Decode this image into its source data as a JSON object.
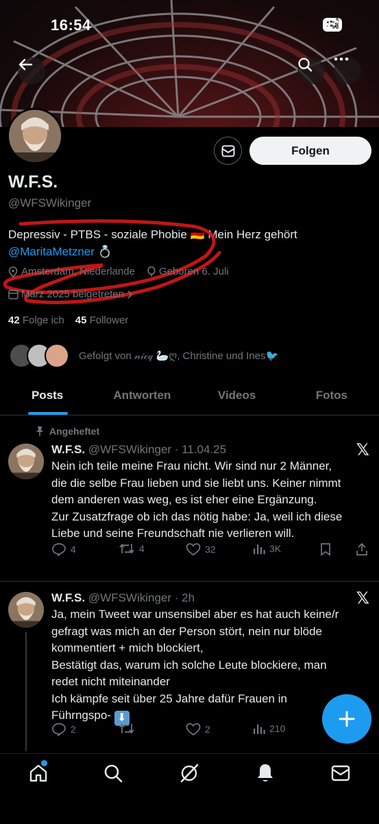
{
  "status_bar": {
    "time": "16:54",
    "battery": "87"
  },
  "profile": {
    "follow_label": "Folgen",
    "name": "W.F.S.",
    "handle": "@WFSWikinger",
    "bio_text": "Depressiv - PTBS - soziale Phobie 🇩🇪 Mein Herz gehört",
    "bio_mention": "@MaritaMetzner",
    "bio_suffix": "💍",
    "location": "Amsterdam, Niederlande",
    "birthday": "Geboren 6. Juli",
    "joined": "März 2025 beigetreten",
    "following_count": "42",
    "following_label": "Folge ich",
    "followers_count": "45",
    "followers_label": "Follower",
    "followed_by": "Gefolgt von 𝓃𝒾𝒸𝓆 🦢ღ, Christine und Ines🐦"
  },
  "tabs": [
    "Posts",
    "Antworten",
    "Videos",
    "Fotos"
  ],
  "pinned_label": "Angeheftet",
  "tweets": [
    {
      "name": "W.F.S.",
      "meta": "@WFSWikinger · 11.04.25",
      "x_label": "𝕏",
      "lines": [
        "Nein ich teile meine Frau nicht. Wir sind nur 2 Männer,",
        "die die selbe Frau lieben und sie liebt uns. Keiner nimmt",
        "dem anderen was weg, es ist eher eine Ergänzung.",
        "Zur Zusatzfrage ob ich das nötig habe:  Ja, weil ich diese",
        "Liebe und seine Freundschaft nie verlieren will."
      ],
      "replies": "4",
      "retweets": "4",
      "likes": "32",
      "views": "3K"
    },
    {
      "name": "W.F.S.",
      "meta": "@WFSWikinger · 2h",
      "x_label": "𝕏",
      "lines": [
        "Ja, mein Tweet war unsensibel aber es hat auch keine/r",
        "gefragt was mich an der Person stört, nein  nur blöde",
        "kommentiert + mich blockiert,",
        "Bestätigt das, warum ich solche Leute blockiere, man",
        "redet nicht miteinander",
        "Ich kämpfe seit  über 25 Jahre dafür  Frauen in",
        "Führngspo- "
      ],
      "arrow_emoji": "⬇",
      "replies": "2",
      "retweets": "",
      "likes": "2",
      "views": "210"
    }
  ],
  "colors": {
    "accent": "#1d9bf0",
    "text": "#e7e9ea",
    "muted": "#71767b",
    "border": "#2f3336"
  }
}
